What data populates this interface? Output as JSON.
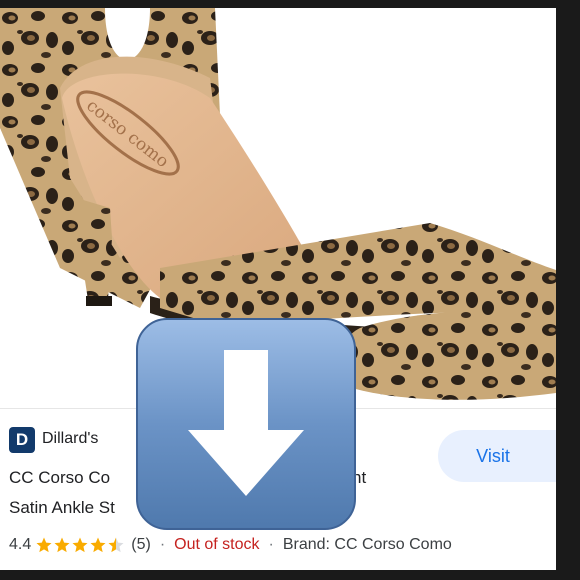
{
  "merchant": {
    "logo_letter": "D",
    "name": "Dillard's"
  },
  "product": {
    "title_line1": "CC Corso Co",
    "title_line1_tail": "nt",
    "title_line2": "Satin Ankle St",
    "image_brand_text": "corso como",
    "image_registered": "®"
  },
  "visit_label": "Visit",
  "rating": {
    "value": "4.4",
    "stars_out_of_5": 4.4,
    "review_count": "(5)",
    "separator": "·",
    "stock_status": "Out of stock",
    "brand_label": "Brand: CC Corso Como"
  },
  "colors": {
    "star": "#f9ab00",
    "out_of_stock": "#c5221f",
    "visit_text": "#1a73e8",
    "visit_bg": "#e8f0fe",
    "overlay_tile": "#5f86b7"
  },
  "icons": {
    "overlay": "download-arrow-icon",
    "merchant": "dillards-logo-icon"
  }
}
